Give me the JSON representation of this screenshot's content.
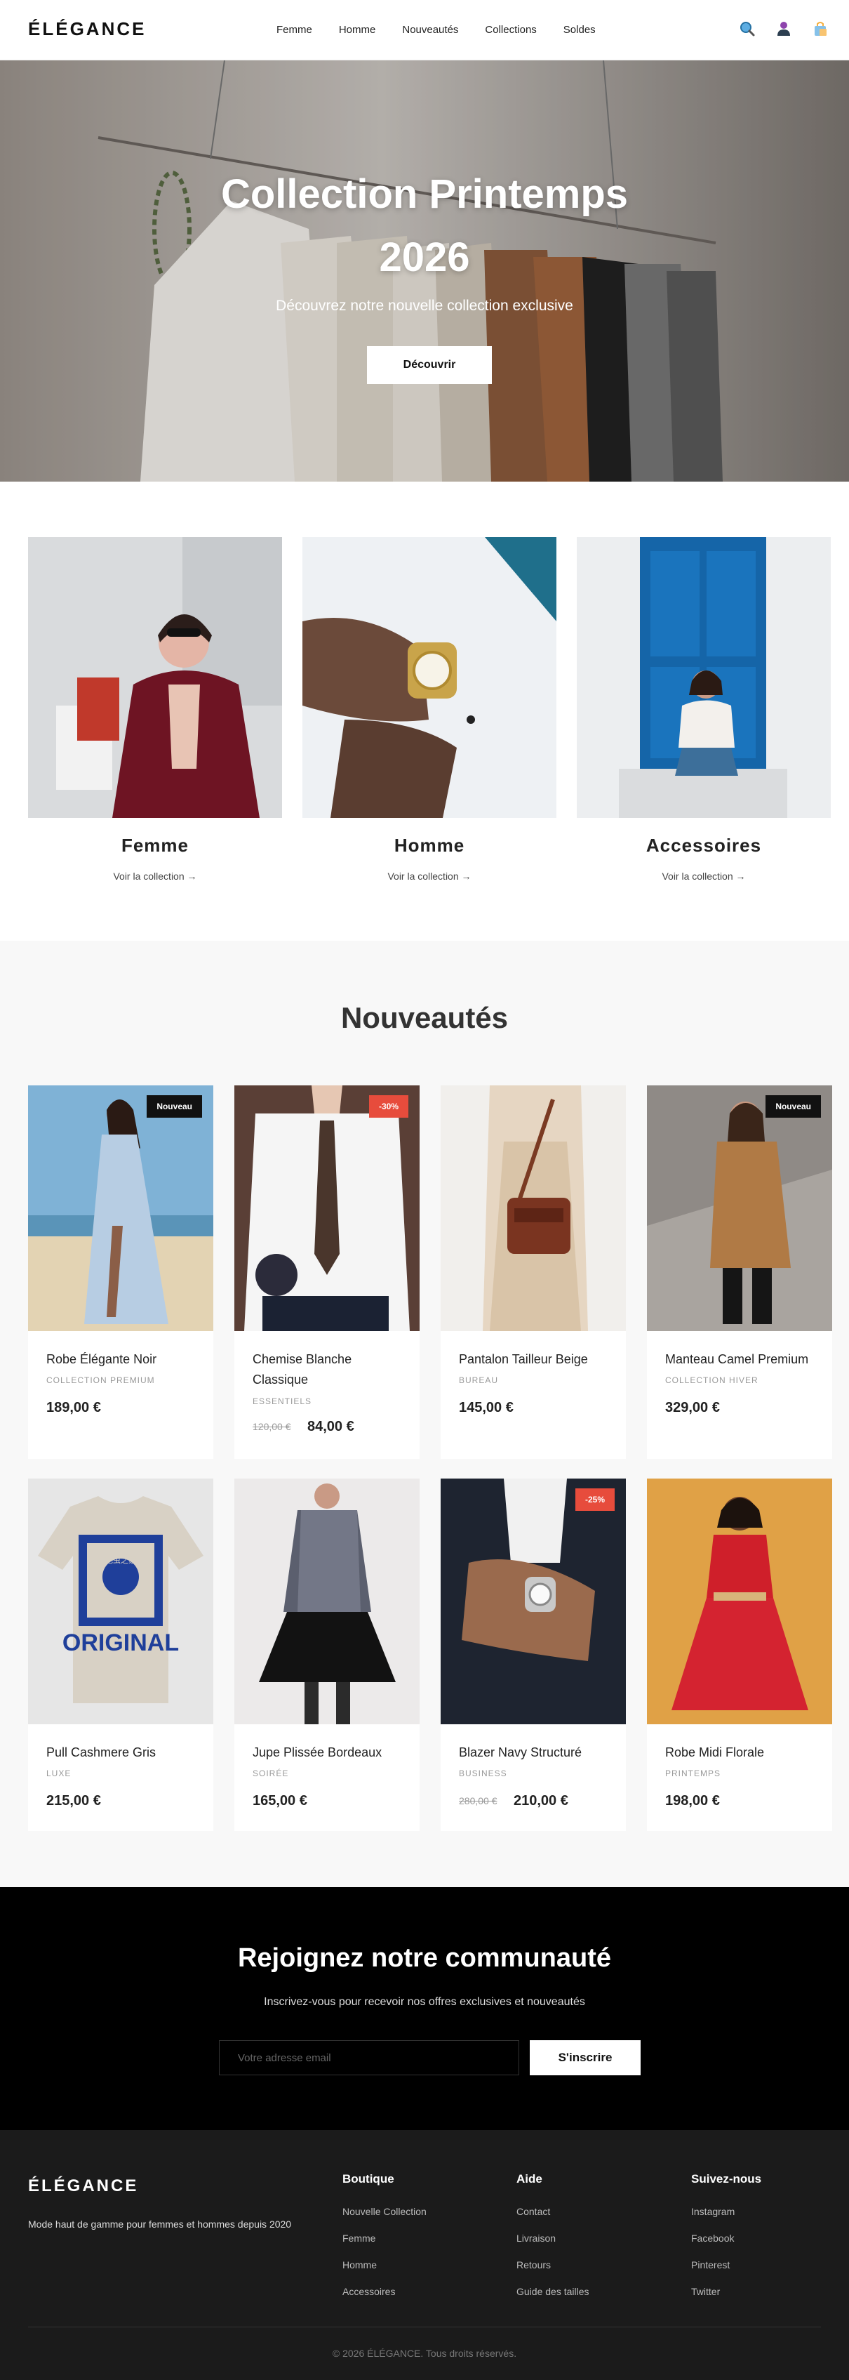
{
  "nav": {
    "logo": "ÉLÉGANCE",
    "items": [
      "Femme",
      "Homme",
      "Nouveautés",
      "Collections",
      "Soldes"
    ],
    "icons": [
      "search-icon",
      "user-icon",
      "cart-icon"
    ]
  },
  "hero": {
    "title": "Collection Printemps 2026",
    "subtitle": "Découvrez notre nouvelle collection exclusive",
    "button": "Découvrir"
  },
  "categories": [
    {
      "title": "Femme",
      "link": "Voir la collection →"
    },
    {
      "title": "Homme",
      "link": "Voir la collection →"
    },
    {
      "title": "Accessoires",
      "link": "Voir la collection →"
    }
  ],
  "new_arrivals": {
    "title": "Nouveautés",
    "products": [
      {
        "name": "Robe Élégante Noir",
        "category": "COLLECTION PREMIUM",
        "price": "189,00 €",
        "badge": "Nouveau"
      },
      {
        "name": "Chemise Blanche Classique",
        "category": "ESSENTIELS",
        "old_price": "120,00 €",
        "price": "84,00 €",
        "badge": "-30%"
      },
      {
        "name": "Pantalon Tailleur Beige",
        "category": "BUREAU",
        "price": "145,00 €"
      },
      {
        "name": "Manteau Camel Premium",
        "category": "COLLECTION HIVER",
        "price": "329,00 €",
        "badge": "Nouveau"
      },
      {
        "name": "Pull Cashmere Gris",
        "category": "LUXE",
        "price": "215,00 €"
      },
      {
        "name": "Jupe Plissée Bordeaux",
        "category": "SOIRÉE",
        "price": "165,00 €"
      },
      {
        "name": "Blazer Navy Structuré",
        "category": "BUSINESS",
        "old_price": "280,00 €",
        "price": "210,00 €",
        "badge": "-25%"
      },
      {
        "name": "Robe Midi Florale",
        "category": "PRINTEMPS",
        "price": "198,00 €"
      }
    ]
  },
  "tshirt_print": {
    "top": "毛虫之家",
    "main": "ORIGINAL"
  },
  "newsletter": {
    "title": "Rejoignez notre communauté",
    "subtitle": "Inscrivez-vous pour recevoir nos offres exclusives et nouveautés",
    "placeholder": "Votre adresse email",
    "button": "S'inscrire"
  },
  "footer": {
    "logo": "ÉLÉGANCE",
    "description": "Mode haut de gamme pour femmes et hommes depuis 2020",
    "columns": [
      {
        "title": "Boutique",
        "links": [
          "Nouvelle Collection",
          "Femme",
          "Homme",
          "Accessoires"
        ]
      },
      {
        "title": "Aide",
        "links": [
          "Contact",
          "Livraison",
          "Retours",
          "Guide des tailles"
        ]
      },
      {
        "title": "Suivez-nous",
        "links": [
          "Instagram",
          "Facebook",
          "Pinterest",
          "Twitter"
        ]
      }
    ],
    "copyright": "© 2026 ÉLÉGANCE. Tous droits réservés."
  },
  "colors": {
    "accent_red": "#e74c3c",
    "badge_dark": "#111111",
    "newsletter_bg": "#000000",
    "footer_bg": "#1b1b1b"
  }
}
